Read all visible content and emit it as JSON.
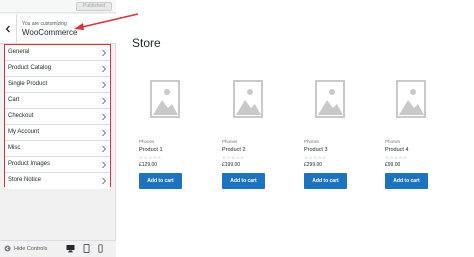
{
  "top_bar": {
    "published_label": "Published"
  },
  "header": {
    "customizing_label": "You are customizing",
    "title": "WooCommerce"
  },
  "panel": {
    "items": [
      {
        "label": "General"
      },
      {
        "label": "Product Catalog"
      },
      {
        "label": "Single Product"
      },
      {
        "label": "Cart"
      },
      {
        "label": "Checkout"
      },
      {
        "label": "My Account"
      },
      {
        "label": "Misc"
      },
      {
        "label": "Product Images"
      },
      {
        "label": "Store Notice"
      }
    ]
  },
  "footer": {
    "hide_controls_label": "Hide Controls"
  },
  "store": {
    "title": "Store",
    "products": [
      {
        "category": "Phones",
        "name": "Product 1",
        "stars": "☆☆☆☆☆",
        "price": "£129.00",
        "button": "Add to cart"
      },
      {
        "category": "Phones",
        "name": "Product 2",
        "stars": "☆☆☆☆☆",
        "price": "£199.00",
        "button": "Add to cart"
      },
      {
        "category": "Phones",
        "name": "Product 3",
        "stars": "☆☆☆☆☆",
        "price": "£299.00",
        "button": "Add to cart"
      },
      {
        "category": "Phones",
        "name": "Product 4",
        "stars": "☆☆☆☆☆",
        "price": "£99.00",
        "button": "Add to cart"
      }
    ]
  },
  "colors": {
    "accent": "#1e73be",
    "highlight": "#d63638"
  }
}
